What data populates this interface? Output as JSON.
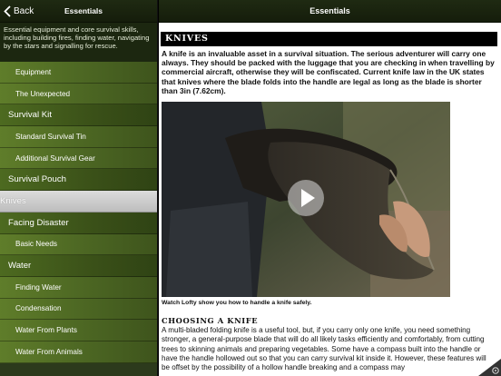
{
  "left_nav": {
    "back_label": "Back",
    "title": "Essentials"
  },
  "intro": "Essential equipment and core survival skills, including building fires, finding water, navigating by the stars and signalling for rescue.",
  "menu": [
    {
      "label": "Equipment",
      "kind": "item"
    },
    {
      "label": "The Unexpected",
      "kind": "item"
    },
    {
      "label": "Survival Kit",
      "kind": "section"
    },
    {
      "label": "Standard Survival Tin",
      "kind": "item"
    },
    {
      "label": "Additional Survival Gear",
      "kind": "item"
    },
    {
      "label": "Survival Pouch",
      "kind": "section"
    },
    {
      "label": "Knives",
      "kind": "selected"
    },
    {
      "label": "Facing Disaster",
      "kind": "section"
    },
    {
      "label": "Basic Needs",
      "kind": "item"
    },
    {
      "label": "Water",
      "kind": "section"
    },
    {
      "label": "Finding Water",
      "kind": "item"
    },
    {
      "label": "Condensation",
      "kind": "item"
    },
    {
      "label": "Water From Plants",
      "kind": "item"
    },
    {
      "label": "Water From Animals",
      "kind": "item"
    }
  ],
  "right_nav": {
    "title": "Essentials"
  },
  "article": {
    "heading": "KNIVES",
    "intro": "A knife is an invaluable asset in a survival situation. The serious adventurer will carry one always. They should be packed with the luggage that you are checking in when travelling by commercial aircraft, otherwise they will be confiscated. Current knife law in the UK states that knives where the blade folds into the handle are legal as long as the blade is shorter than 3in (7.62cm).",
    "video_caption": "Watch Lofty show you how to handle a knife safely.",
    "sub_heading": "CHOOSING A KNIFE",
    "body": "A multi-bladed folding knife is a useful tool, but, if you carry only one knife, you need something stronger, a general-purpose blade that will do all likely tasks efficiently and comfortably, from cutting trees to skinning animals and preparing vegetables. Some have a compass built into the handle or have the handle hollowed out so that you can carry survival kit inside it. However, these features will be offset by the possibility of a hollow handle breaking and a compass may"
  },
  "colors": {
    "nav_bar": "#1a2410",
    "menu_green": "#4a6422",
    "selected_row": "#c8c8c8",
    "heading_bar": "#000000"
  },
  "icons": {
    "back": "chevron-left-icon",
    "play": "play-icon",
    "corner": "page-curl-icon"
  }
}
